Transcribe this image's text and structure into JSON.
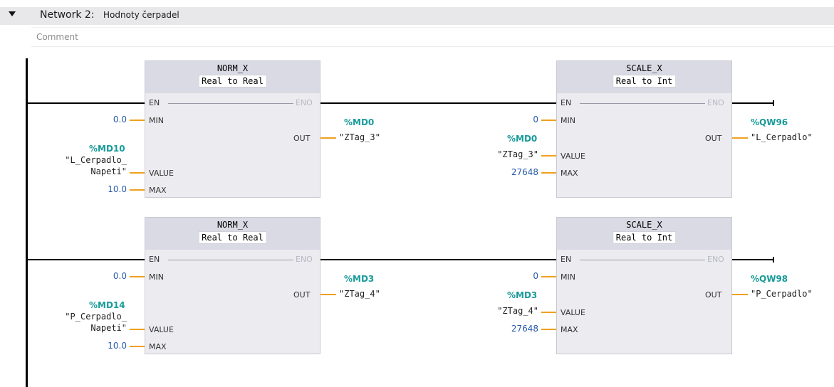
{
  "network": {
    "title": "Network 2:",
    "description": "Hodnoty čerpadel",
    "comment_placeholder": "Comment"
  },
  "pins": {
    "en": "EN",
    "eno": "ENO",
    "min": "MIN",
    "value": "VALUE",
    "max": "MAX",
    "out": "OUT"
  },
  "rung1": {
    "norm": {
      "name": "NORM_X",
      "type_from": "Real",
      "type_to": "Real",
      "to_word": "to",
      "min_value": "0.0",
      "max_value": "10.0",
      "value_addr": "%MD10",
      "value_tag_line1": "\"L_Cerpadlo_",
      "value_tag_line2": "Napeti\"",
      "out_addr": "%MD0",
      "out_tag": "\"ZTag_3\""
    },
    "scale": {
      "name": "SCALE_X",
      "type_from": "Real",
      "type_to": "Int",
      "to_word": "to",
      "min_value": "0",
      "max_value": "27648",
      "value_addr": "%MD0",
      "value_tag": "\"ZTag_3\"",
      "out_addr": "%QW96",
      "out_tag": "\"L_Cerpadlo\""
    }
  },
  "rung2": {
    "norm": {
      "name": "NORM_X",
      "type_from": "Real",
      "type_to": "Real",
      "to_word": "to",
      "min_value": "0.0",
      "max_value": "10.0",
      "value_addr": "%MD14",
      "value_tag_line1": "\"P_Cerpadlo_",
      "value_tag_line2": "Napeti\"",
      "out_addr": "%MD3",
      "out_tag": "\"ZTag_4\""
    },
    "scale": {
      "name": "SCALE_X",
      "type_from": "Real",
      "type_to": "Int",
      "to_word": "to",
      "min_value": "0",
      "max_value": "27648",
      "value_addr": "%MD3",
      "value_tag": "\"ZTag_4\"",
      "out_addr": "%QW98",
      "out_tag": "\"P_Cerpadlo\""
    }
  }
}
